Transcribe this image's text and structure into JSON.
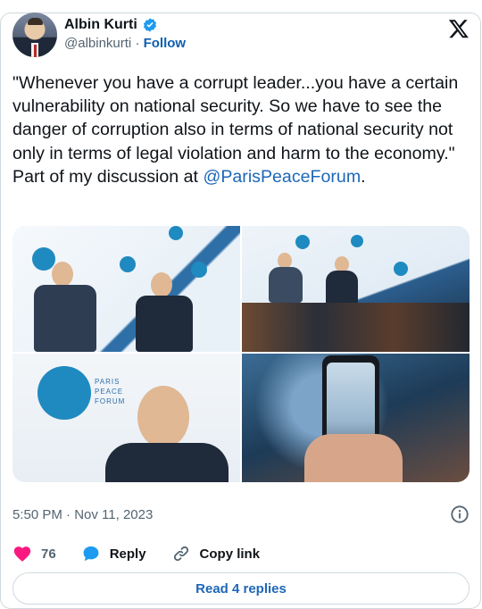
{
  "author": {
    "name": "Albin Kurti",
    "handle": "@albinkurti",
    "separator": "·",
    "follow_label": "Follow"
  },
  "tweet": {
    "text": "\"Whenever you have a corrupt leader...you have a certain vulnerability on national security. So we have to see the danger of corruption also in terms of national security not only in terms of legal violation and harm to the economy.\" Part of my discussion at ",
    "mention": "@ParisPeaceForum",
    "text_end": ".",
    "timestamp": "5:50 PM · Nov 11, 2023"
  },
  "media": {
    "photos": [
      {
        "name": "panel-two-speakers"
      },
      {
        "name": "panel-audience-view"
      },
      {
        "name": "speaker-closeup-logo"
      },
      {
        "name": "phone-recording-panel"
      }
    ],
    "logo_text": "PARIS PEACE FORUM"
  },
  "actions": {
    "likes": "76",
    "reply_label": "Reply",
    "copy_label": "Copy link"
  },
  "read_replies_label": "Read 4 replies",
  "colors": {
    "accent": "#1d9bf0",
    "like": "#f91880",
    "text_secondary": "#536471",
    "border": "#cfd9de"
  },
  "icons": {
    "verified": "verified-badge-icon",
    "logo": "x-logo-icon",
    "info": "info-icon",
    "like": "heart-icon",
    "reply": "reply-bubble-icon",
    "copy": "link-icon"
  }
}
